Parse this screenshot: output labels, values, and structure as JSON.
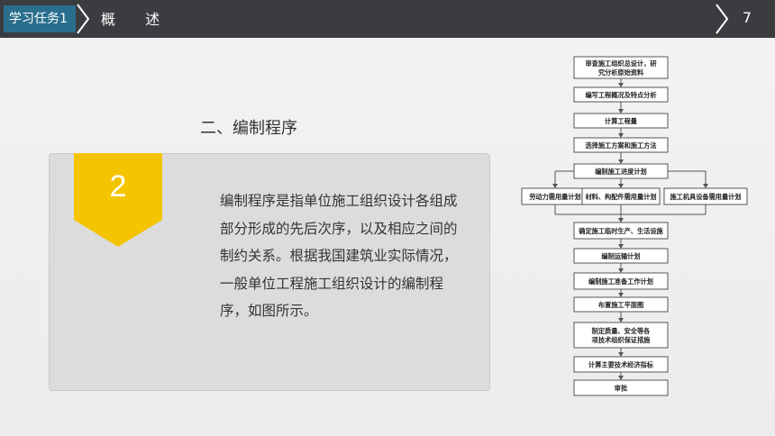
{
  "header": {
    "task_label": "学习任务1",
    "section_title": "概 述",
    "page_number": "7"
  },
  "main": {
    "heading": "二、编制程序",
    "badge_number": "2",
    "description": "编制程序是指单位施工组织设计各组成部分形成的先后次序，以及相应之间的制约关系。根据我国建筑业实际情况，一般单位工程施工组织设计的编制程序，如图所示。"
  },
  "flowchart": {
    "steps": [
      [
        "审查施工组织总设计，研",
        "究分析原始资料"
      ],
      [
        "编写工程概况及特点分析"
      ],
      [
        "计算工程量"
      ],
      [
        "选择施工方案和施工方法"
      ],
      [
        "编制施工进度计划"
      ]
    ],
    "branches": [
      "劳动力需用量计划",
      "材料、构配件需用量计划",
      "施工机具设备需用量计划"
    ],
    "steps_after": [
      [
        "确定施工临时生产、生活设施"
      ],
      [
        "编制运输计划"
      ],
      [
        "编制施工准备工作计划"
      ],
      [
        "布置施工平面图"
      ],
      [
        "制定质量、安全等各",
        "项技术组织保证措施"
      ],
      [
        "计算主要技术经济指标"
      ],
      [
        "审批"
      ]
    ]
  },
  "colors": {
    "topbar": "#3a3c3f",
    "task_tab": "#2a6e8e",
    "badge": "#f5c400",
    "panel": "#dcdcdc"
  }
}
